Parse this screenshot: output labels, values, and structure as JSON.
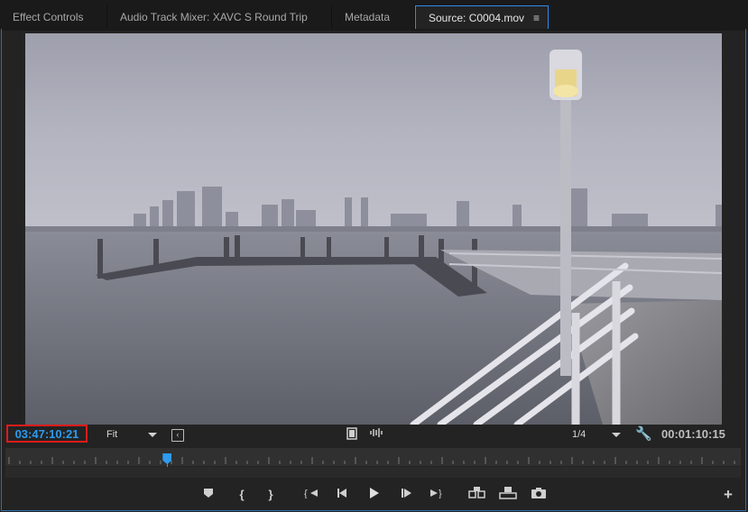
{
  "tabs": [
    {
      "label": "Effect Controls",
      "active": false
    },
    {
      "label": "Audio Track Mixer: XAVC S Round Trip",
      "active": false
    },
    {
      "label": "Metadata",
      "active": false
    },
    {
      "label": "Source: C0004.mov",
      "active": true
    }
  ],
  "panel_menu_icon": "hamburger-icon",
  "source_monitor": {
    "playhead_timecode": "03:47:10:21",
    "zoom_label": "Fit",
    "resolution_label": "1/4",
    "duration_timecode": "00:01:10:15",
    "playhead_position": 0.22
  },
  "icons": {
    "safe_margins": "safe-margins-icon",
    "drag_video": "film-icon",
    "drag_audio": "waveform-icon",
    "settings": "wrench-icon",
    "add_marker": "marker-icon",
    "mark_in": "mark-in-icon",
    "mark_out": "mark-out-icon",
    "go_to_in": "go-to-in-icon",
    "step_back": "step-back-icon",
    "play": "play-icon",
    "step_forward": "step-forward-icon",
    "go_to_out": "go-to-out-icon",
    "insert": "insert-icon",
    "overwrite": "overwrite-icon",
    "export_frame": "camera-icon",
    "button_editor": "plus-icon"
  },
  "colors": {
    "accent": "#2d9bf0",
    "highlight_box": "#e01b1b"
  }
}
